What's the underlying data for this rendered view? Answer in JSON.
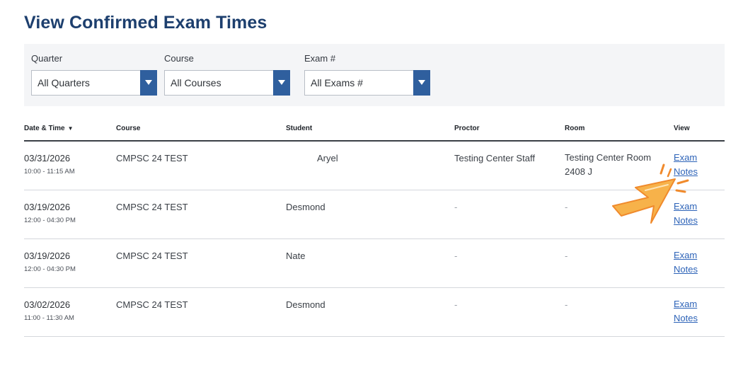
{
  "page": {
    "title": "View Confirmed Exam Times"
  },
  "filters": {
    "quarter": {
      "label": "Quarter",
      "value": "All Quarters"
    },
    "course": {
      "label": "Course",
      "value": "All Courses"
    },
    "exam": {
      "label": "Exam #",
      "value": "All Exams #"
    }
  },
  "table": {
    "headers": {
      "date_time": "Date & Time",
      "course": "Course",
      "student": "Student",
      "proctor": "Proctor",
      "room": "Room",
      "view": "View"
    },
    "sort_indicator": "▼",
    "rows": [
      {
        "date": "03/31/2026",
        "time": "10:00 - 11:15 AM",
        "course": "CMPSC 24 TEST",
        "student": "Aryel",
        "proctor": "Testing Center Staff",
        "room": "Testing Center Room 2408 J",
        "link_exam": "Exam",
        "link_notes": "Notes"
      },
      {
        "date": "03/19/2026",
        "time": "12:00 - 04:30 PM",
        "course": "CMPSC 24 TEST",
        "student": "Desmond",
        "proctor": "-",
        "room": "-",
        "link_exam": "Exam",
        "link_notes": "Notes"
      },
      {
        "date": "03/19/2026",
        "time": "12:00 - 04:30 PM",
        "course": "CMPSC 24 TEST",
        "student": "Nate",
        "proctor": "-",
        "room": "-",
        "link_exam": "Exam",
        "link_notes": "Notes"
      },
      {
        "date": "03/02/2026",
        "time": "11:00 - 11:30 AM",
        "course": "CMPSC 24 TEST",
        "student": "Desmond",
        "proctor": "-",
        "room": "-",
        "link_exam": "Exam",
        "link_notes": "Notes"
      }
    ]
  },
  "colors": {
    "title": "#1d3f6e",
    "select_button": "#2f5f9e",
    "link": "#2d63b8",
    "pointer_fill": "#f7b24a",
    "pointer_stroke": "#f08a2c"
  },
  "icons": {
    "select_arrow": "chevron-down-icon",
    "pointer": "cursor-arrow-icon"
  }
}
